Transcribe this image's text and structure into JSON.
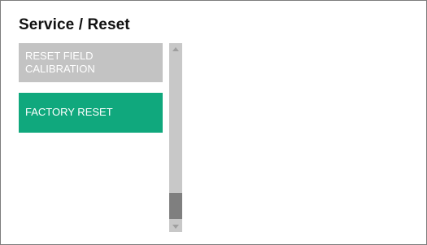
{
  "title": "Service / Reset",
  "menu": {
    "items": [
      {
        "label": "RESET FIELD\nCALIBRATION",
        "state": "disabled",
        "color": "#c3c3c3"
      },
      {
        "label": "FACTORY RESET",
        "state": "active",
        "color": "#10a87d"
      }
    ]
  },
  "scrollbar": {
    "position_fraction": 0.86,
    "visible_fraction": 0.16
  }
}
